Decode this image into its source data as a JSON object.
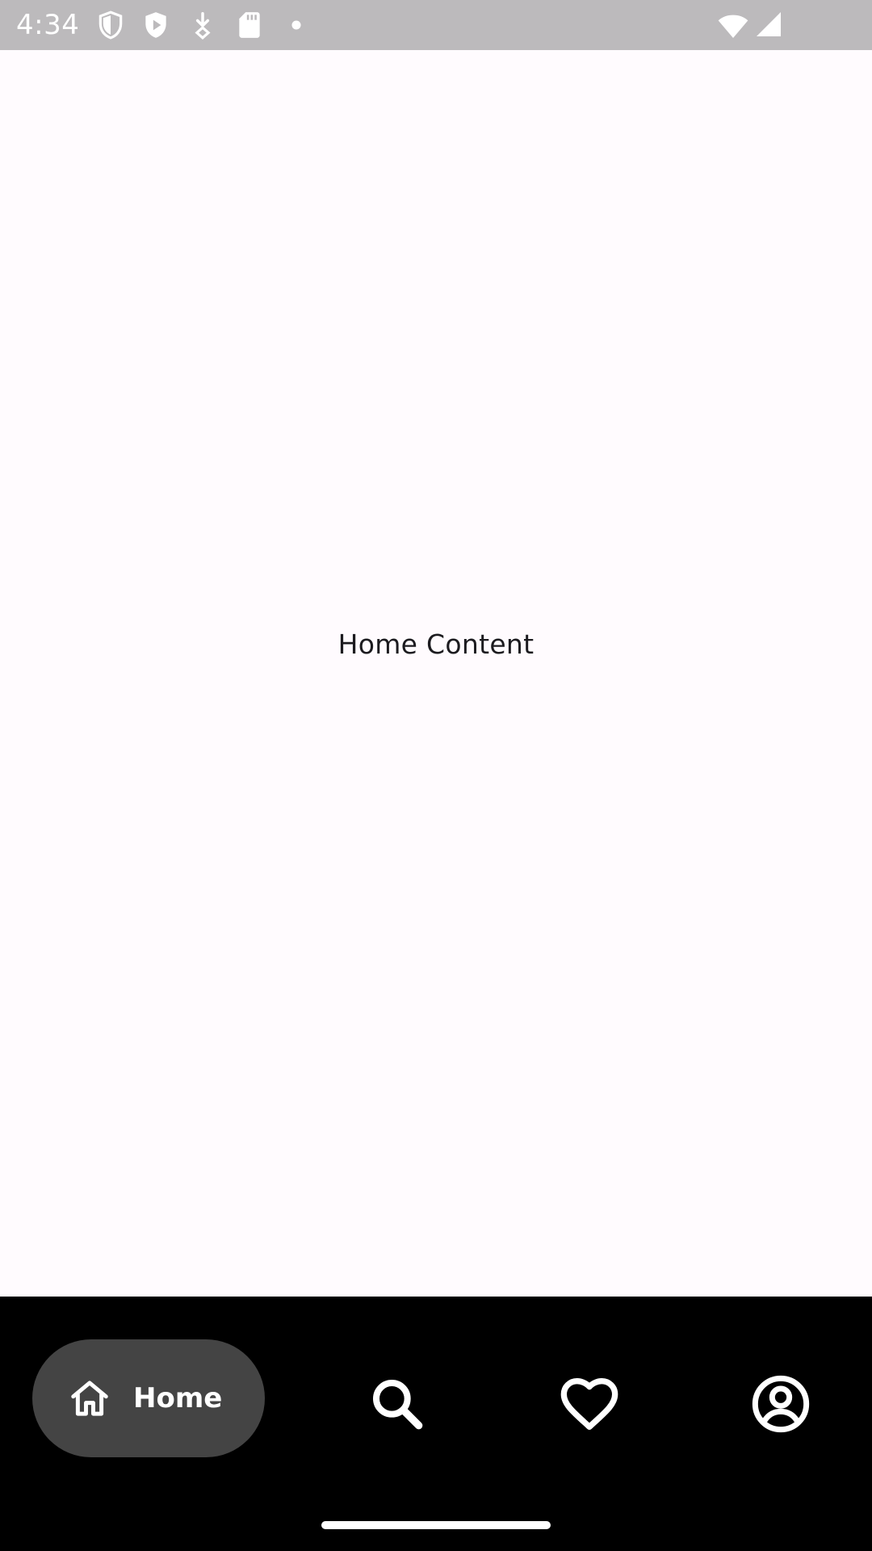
{
  "status_bar": {
    "time": "4:34",
    "icons": [
      "shield-outline-icon",
      "shield-play-icon",
      "download-arrow-icon",
      "sd-card-icon",
      "dot-icon",
      "wifi-icon",
      "cell-signal-icon"
    ]
  },
  "main": {
    "content_text": "Home Content"
  },
  "bottom_nav": {
    "items": [
      {
        "label": "Home",
        "icon": "home-icon",
        "selected": true
      },
      {
        "icon": "search-icon",
        "selected": false
      },
      {
        "icon": "heart-icon",
        "selected": false
      },
      {
        "icon": "account-circle-icon",
        "selected": false
      }
    ]
  },
  "colors": {
    "background": "#fffbfe",
    "status_bar": "#bcbabc",
    "nav_bar": "#000000",
    "nav_pill": "#444444",
    "text": "#1c1b1f",
    "nav_icon": "#ffffff"
  }
}
